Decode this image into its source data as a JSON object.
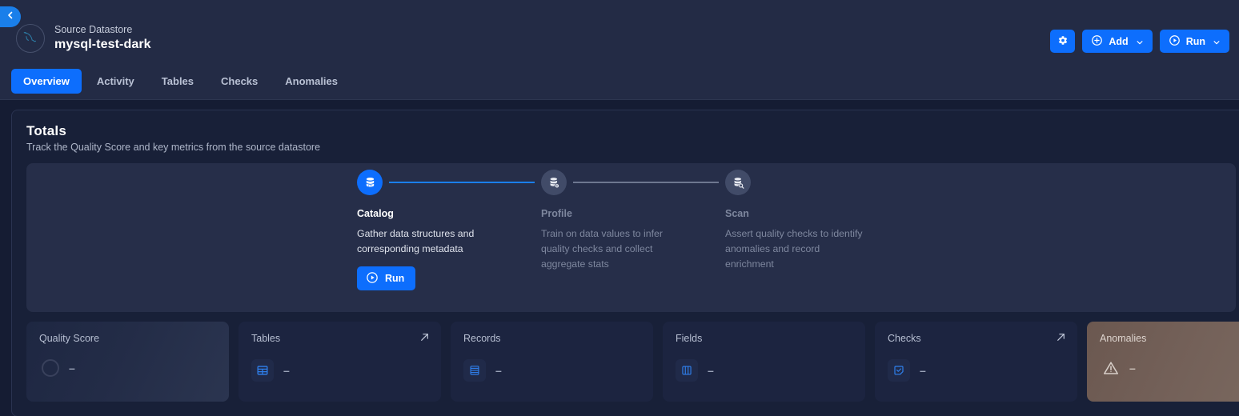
{
  "header": {
    "back_icon": "chevron-left-icon",
    "datastore_label": "Source Datastore",
    "datastore_name": "mysql-test-dark",
    "avatar_icon": "mysql-dolphin-icon",
    "actions": {
      "settings_icon": "gear-icon",
      "add_label": "Add",
      "add_icon": "plus-circle-icon",
      "run_label": "Run",
      "run_icon": "play-circle-icon",
      "caret_icon": "chevron-down-icon"
    }
  },
  "tabs": [
    {
      "label": "Overview",
      "active": true
    },
    {
      "label": "Activity",
      "active": false
    },
    {
      "label": "Tables",
      "active": false
    },
    {
      "label": "Checks",
      "active": false
    },
    {
      "label": "Anomalies",
      "active": false
    }
  ],
  "totals": {
    "title": "Totals",
    "subtitle": "Track the Quality Score and key metrics from the source datastore"
  },
  "stepper": {
    "steps": [
      {
        "name": "Catalog",
        "description": "Gather data structures and corresponding metadata",
        "icon": "database-icon",
        "state": "active",
        "run_label": "Run"
      },
      {
        "name": "Profile",
        "description": "Train on data values to infer quality checks and collect aggregate stats",
        "icon": "database-gear-icon",
        "state": "pending"
      },
      {
        "name": "Scan",
        "description": "Assert quality checks to identify anomalies and record enrichment",
        "icon": "database-search-icon",
        "state": "pending"
      }
    ]
  },
  "metrics": [
    {
      "title": "Quality Score",
      "value": "–",
      "icon": "donut-ring-icon",
      "arrow": false,
      "variant": "quality"
    },
    {
      "title": "Tables",
      "value": "–",
      "icon": "table-grid-icon",
      "arrow": true,
      "variant": "normal"
    },
    {
      "title": "Records",
      "value": "–",
      "icon": "records-rows-icon",
      "arrow": false,
      "variant": "normal"
    },
    {
      "title": "Fields",
      "value": "–",
      "icon": "columns-icon",
      "arrow": false,
      "variant": "normal"
    },
    {
      "title": "Checks",
      "value": "–",
      "icon": "check-note-icon",
      "arrow": true,
      "variant": "normal"
    },
    {
      "title": "Anomalies",
      "value": "–",
      "icon": "warning-triangle-icon",
      "arrow": true,
      "variant": "anomalies"
    }
  ],
  "colors": {
    "page_bg": "#151c33",
    "header_bg": "#232b45",
    "accent": "#0d6efd",
    "card_bg": "#1c2440",
    "panel_bg": "#262e49",
    "anomaly_bg": "#746159"
  }
}
